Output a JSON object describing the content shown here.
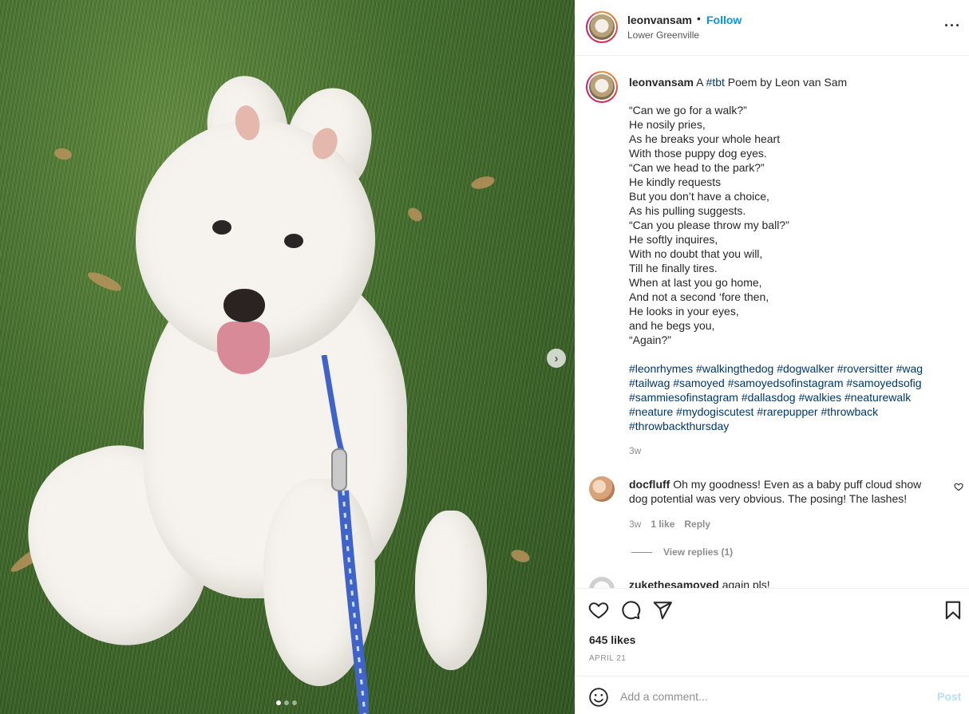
{
  "post": {
    "username": "leonvansam",
    "follow_label": "Follow",
    "separator": "•",
    "location": "Lower Greenville",
    "more_label": "···"
  },
  "caption": {
    "username": "leonvansam",
    "prefix": "A",
    "tag": "#tbt",
    "title_rest": "Poem by Leon van Sam",
    "poem_lines": [
      "“Can we go for a walk?”",
      "He nosily pries,",
      "As he breaks your whole heart",
      "With those puppy dog eyes.",
      "“Can we head to the park?”",
      "He kindly requests",
      "But you don’t have a choice,",
      "As his pulling suggests.",
      "“Can you please throw my ball?”",
      "He softly inquires,",
      "With no doubt that you will,",
      "Till he finally tires.",
      "When at last you go home,",
      "And not a second ‘fore then,",
      "He looks in your eyes,",
      "and he begs you,",
      "“Again?”"
    ],
    "hashtags": [
      "#leonrhymes #walkingthedog #dogwalker #roversitter #wag",
      "#tailwag #samoyed #samoyedsofinstagram #samoyedsofig",
      "#sammiesofinstagram #dallasdog #walkies #neaturewalk",
      "#neature #mydogiscutest #rarepupper #throwback",
      "#throwbackthursday"
    ],
    "time": "3w"
  },
  "comments": [
    {
      "username": "docfluff",
      "text": "Oh my goodness! Even as a baby puff cloud show dog potential was very obvious. The posing! The lashes!",
      "time": "3w",
      "likes": "1 like",
      "reply_label": "Reply",
      "view_replies": "View replies (1)"
    },
    {
      "username": "zukethesamoyed",
      "text": "again pls!"
    }
  ],
  "actions": {
    "likes": "645 likes",
    "date": "APRIL 21"
  },
  "add_comment": {
    "placeholder": "Add a comment...",
    "post_label": "Post"
  },
  "media": {
    "next_label": "›",
    "carousel_count": 3,
    "carousel_active": 1
  },
  "colors": {
    "accent": "#0095f6",
    "hashtag": "#00376b",
    "muted": "#8e8e8e",
    "post_disabled": "#b2dffc"
  }
}
